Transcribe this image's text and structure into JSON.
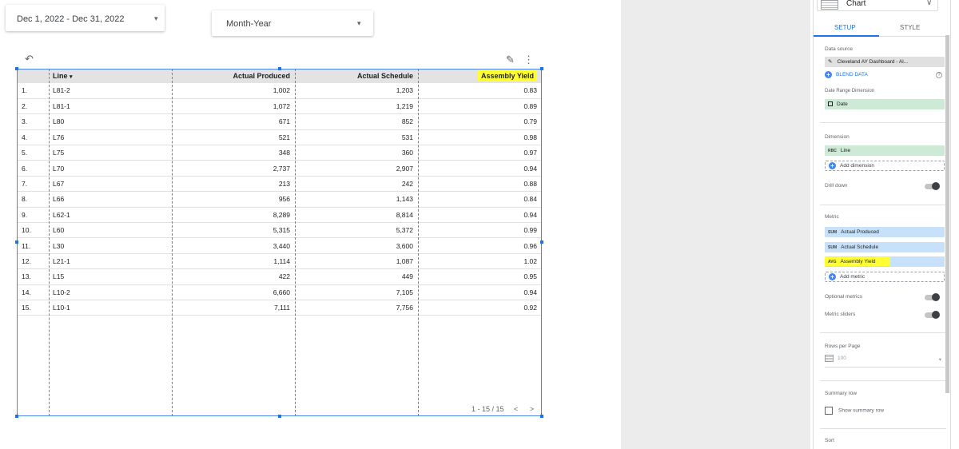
{
  "controls": {
    "date_range": "Dec 1, 2022 - Dec 31, 2022",
    "dimension_select": "Month-Year",
    "dropdown_arrow": "▾"
  },
  "table": {
    "headers": [
      "",
      "Line",
      "Actual Produced",
      "Actual Schedule",
      "Assembly Yield"
    ],
    "sort_indicator": "▾",
    "rows": [
      {
        "idx": "1.",
        "line": "L81-2",
        "produced": "1,002",
        "schedule": "1,203",
        "yield": "0.83"
      },
      {
        "idx": "2.",
        "line": "L81-1",
        "produced": "1,072",
        "schedule": "1,219",
        "yield": "0.89"
      },
      {
        "idx": "3.",
        "line": "L80",
        "produced": "671",
        "schedule": "852",
        "yield": "0.79"
      },
      {
        "idx": "4.",
        "line": "L76",
        "produced": "521",
        "schedule": "531",
        "yield": "0.98"
      },
      {
        "idx": "5.",
        "line": "L75",
        "produced": "348",
        "schedule": "360",
        "yield": "0.97"
      },
      {
        "idx": "6.",
        "line": "L70",
        "produced": "2,737",
        "schedule": "2,907",
        "yield": "0.94"
      },
      {
        "idx": "7.",
        "line": "L67",
        "produced": "213",
        "schedule": "242",
        "yield": "0.88"
      },
      {
        "idx": "8.",
        "line": "L66",
        "produced": "956",
        "schedule": "1,143",
        "yield": "0.84"
      },
      {
        "idx": "9.",
        "line": "L62-1",
        "produced": "8,289",
        "schedule": "8,814",
        "yield": "0.94"
      },
      {
        "idx": "10.",
        "line": "L60",
        "produced": "5,315",
        "schedule": "5,372",
        "yield": "0.99"
      },
      {
        "idx": "11.",
        "line": "L30",
        "produced": "3,440",
        "schedule": "3,600",
        "yield": "0.96"
      },
      {
        "idx": "12.",
        "line": "L21-1",
        "produced": "1,114",
        "schedule": "1,087",
        "yield": "1.02"
      },
      {
        "idx": "13.",
        "line": "L15",
        "produced": "422",
        "schedule": "449",
        "yield": "0.95"
      },
      {
        "idx": "14.",
        "line": "L10-2",
        "produced": "6,660",
        "schedule": "7,105",
        "yield": "0.94"
      },
      {
        "idx": "15.",
        "line": "L10-1",
        "produced": "7,111",
        "schedule": "7,756",
        "yield": "0.92"
      }
    ],
    "pager": {
      "range": "1 - 15 / 15",
      "prev": "<",
      "next": ">"
    },
    "highlight_color": "#ffff33",
    "selection_color": "#4a86e8"
  },
  "toolbar": {
    "undo": "↶",
    "edit": "✎",
    "more": "⋮"
  },
  "panel": {
    "chart_label": "Chart",
    "chart_chevron": "∨",
    "tabs": [
      "SETUP",
      "STYLE"
    ],
    "data_source_label": "Data source",
    "data_source_value": "Cleveland AY Dashboard - Al...",
    "blend_label": "BLEND DATA",
    "help": "?",
    "date_range_dim_label": "Date Range Dimension",
    "date_value": "Date",
    "dimension_label": "Dimension",
    "dimension_prefix": "RBC",
    "dimension_value": "Line",
    "add_dimension": "Add dimension",
    "drill_down": "Drill down",
    "metric_label": "Metric",
    "metrics": [
      {
        "prefix": "SUM",
        "name": "Actual Produced"
      },
      {
        "prefix": "SUM",
        "name": "Actual Schedule"
      },
      {
        "prefix": "AVG",
        "name": "Assembly Yield"
      }
    ],
    "add_metric": "Add metric",
    "optional_metrics": "Optional metrics",
    "metric_sliders": "Metric sliders",
    "rows_per_page_label": "Rows per Page",
    "rows_per_page_value": "100",
    "summary_row_label": "Summary row",
    "show_summary_row": "Show summary row",
    "sort_label": "Sort"
  }
}
